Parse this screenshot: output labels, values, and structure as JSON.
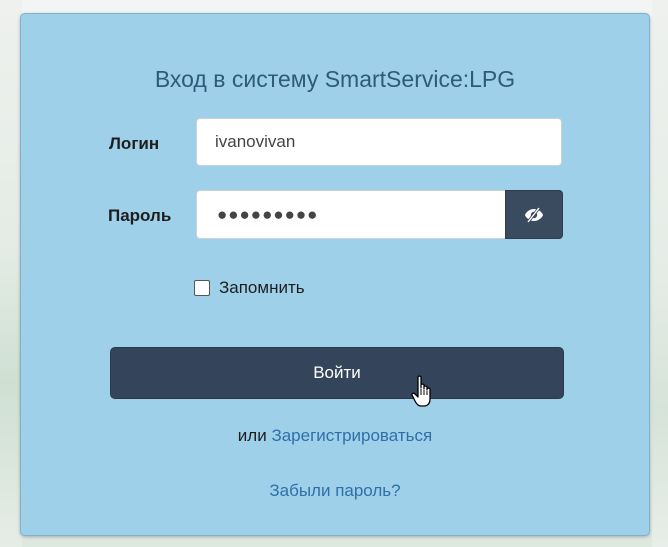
{
  "form": {
    "title": "Вход в систему SmartService:LPG",
    "login_label": "Логин",
    "login_value": "ivanovivan",
    "password_label": "Пароль",
    "password_masked": "●●●●●●●●●",
    "toggle_icon": "eye-slash-icon",
    "remember_label": "Запомнить",
    "remember_checked": false,
    "submit_label": "Войти",
    "or_text": "или",
    "register_link": "Зарегистрироваться",
    "forgot_link": "Забыли пароль?"
  },
  "colors": {
    "panel_bg": "#9fd0e9",
    "button_bg": "#34455b",
    "link": "#2f6fa8",
    "title": "#2f5b7a"
  }
}
